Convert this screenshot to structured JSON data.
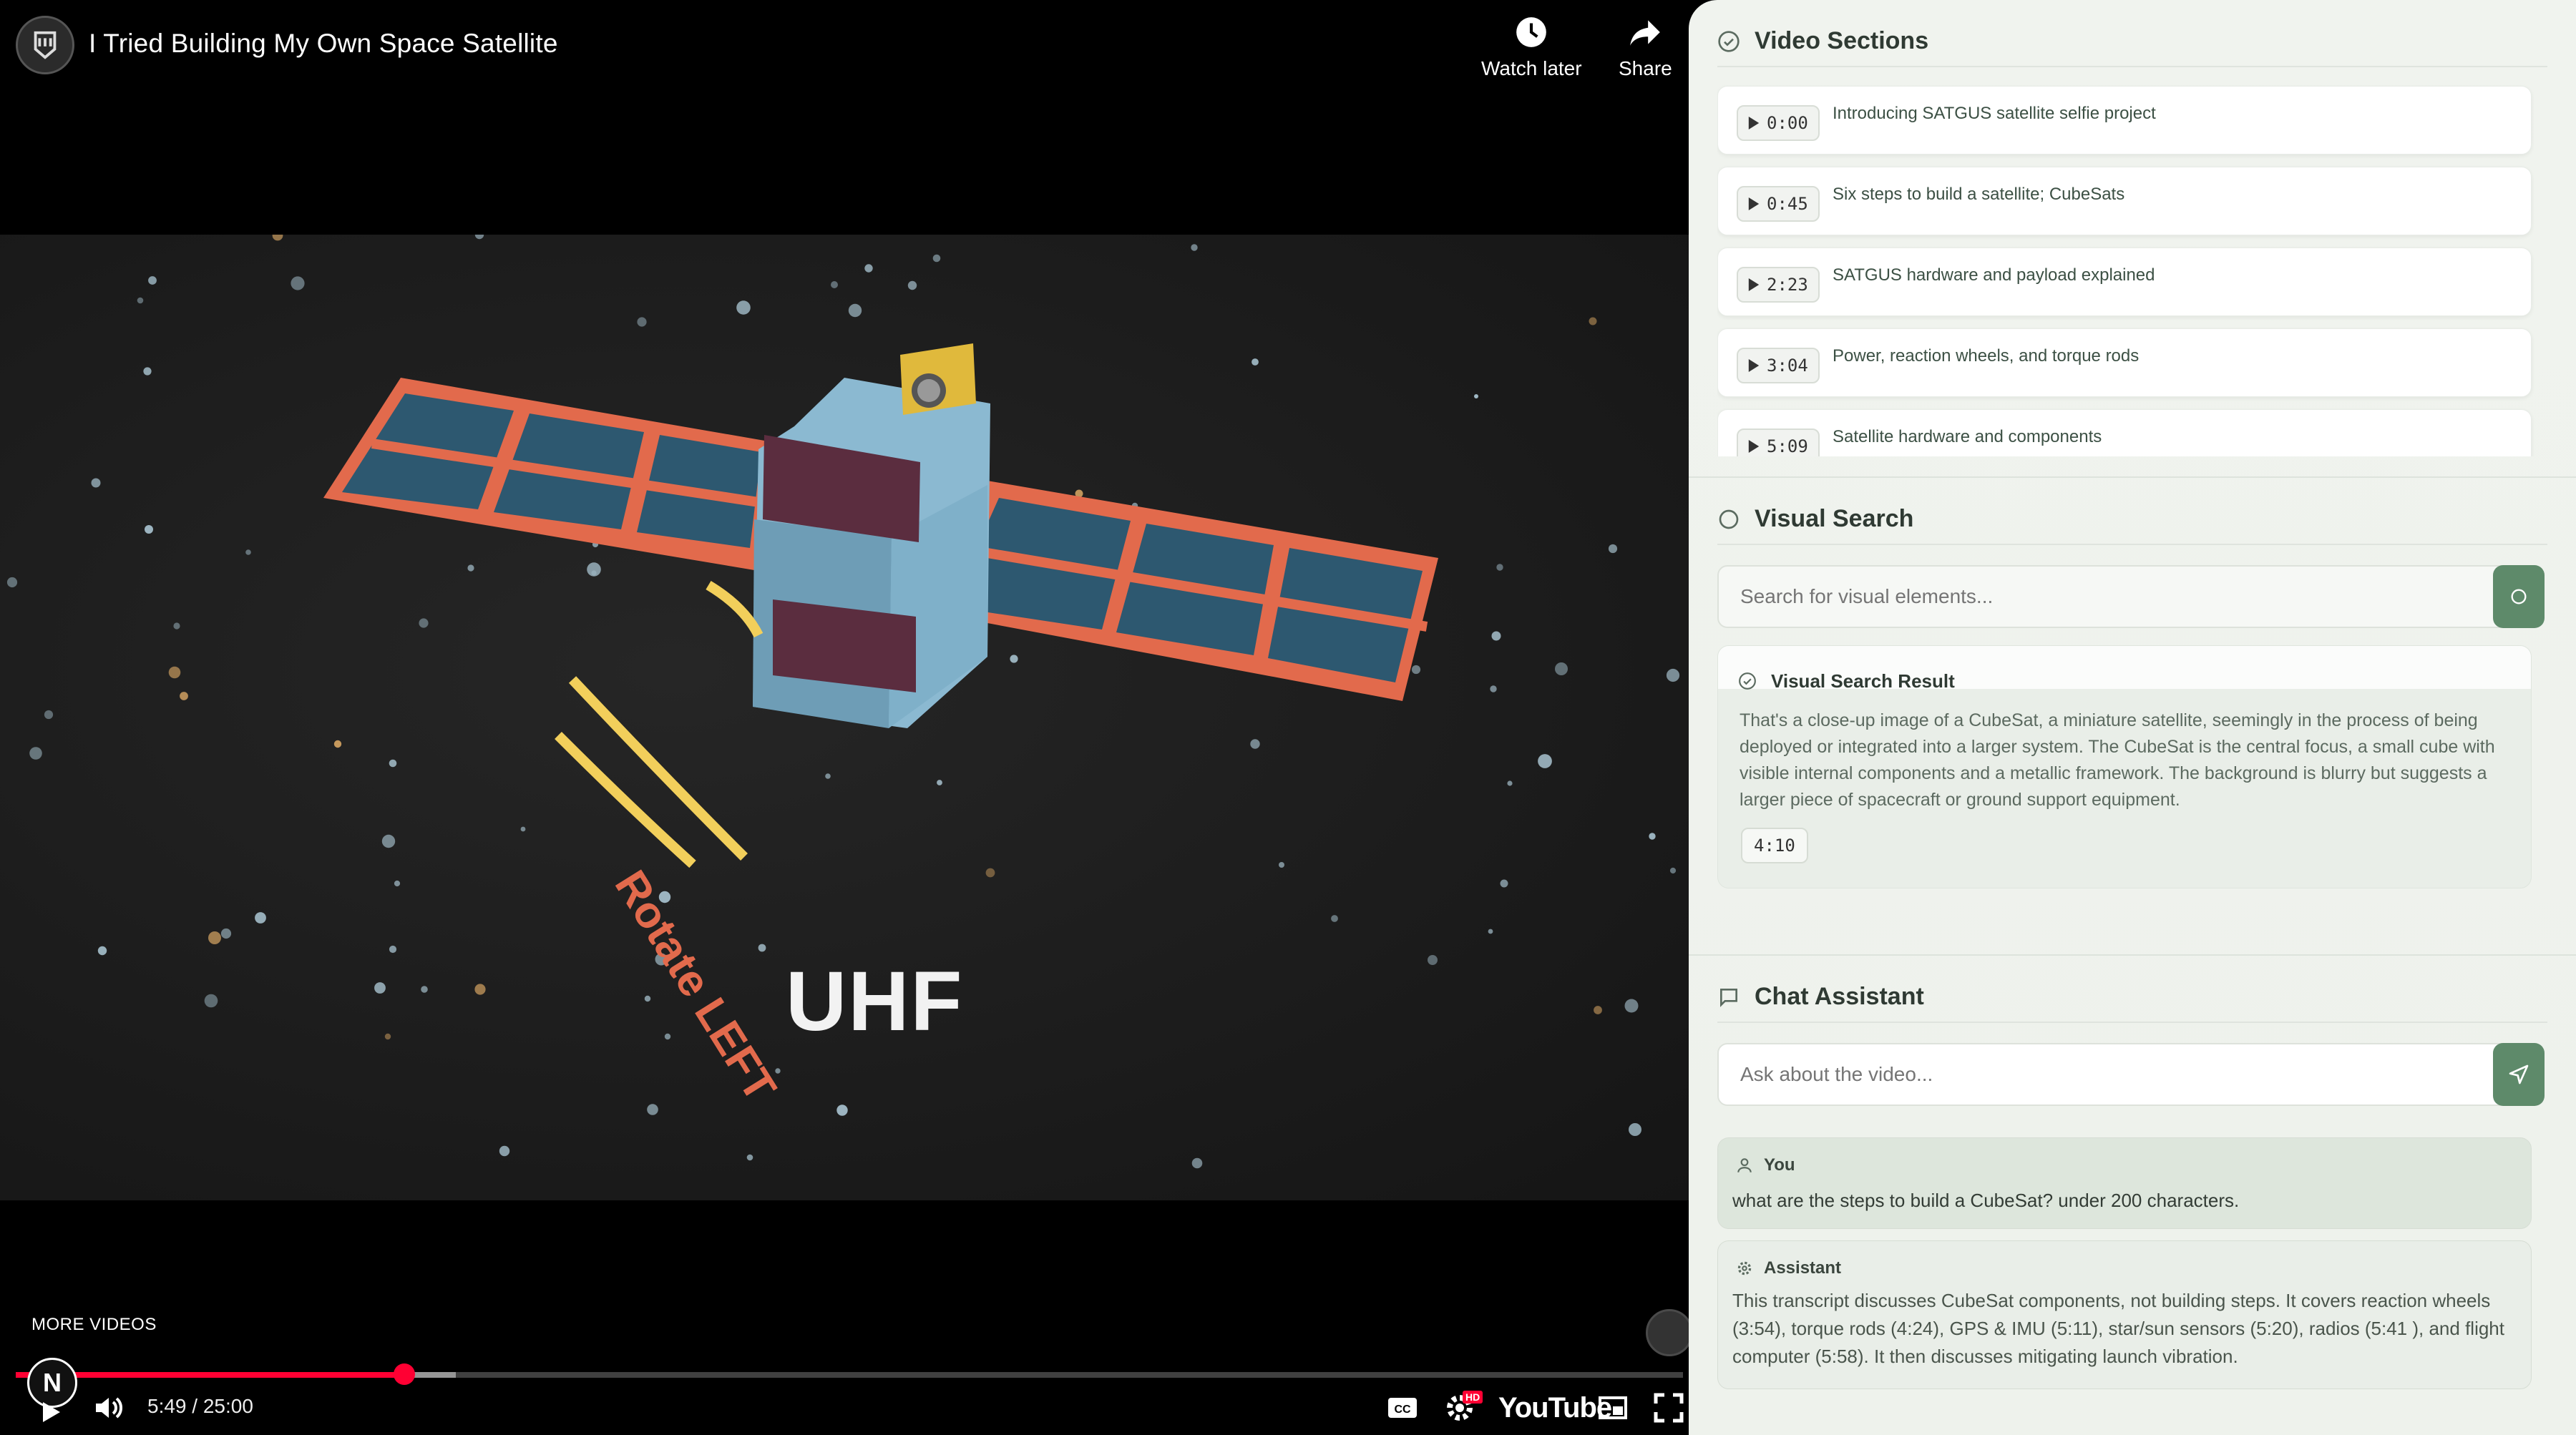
{
  "player": {
    "title": "I Tried Building My Own Space Satellite",
    "watch_later": "Watch later",
    "share": "Share",
    "scene_text": "UHF",
    "rotate_text": "Rotate LEFT",
    "more_videos": "MORE VIDEOS",
    "n_badge": "N",
    "time": "5:49 / 25:00",
    "progress_played_fraction": 0.233,
    "progress_loaded_fraction": 0.264,
    "youtube_label": "YouTube",
    "hd_badge": "HD",
    "icons": [
      "channel-logo-icon",
      "clock-icon",
      "share-arrow-icon",
      "play-icon",
      "volume-icon",
      "captions-icon",
      "settings-gear-icon",
      "miniplayer-icon",
      "fullscreen-icon"
    ],
    "accent_color": "#ff0033"
  },
  "panel": {
    "video_sections": {
      "title": "Video Sections",
      "items": [
        {
          "time": "0:00",
          "label": "Introducing SATGUS satellite selfie project"
        },
        {
          "time": "0:45",
          "label": "Six steps to build a satellite; CubeSats"
        },
        {
          "time": "2:23",
          "label": "SATGUS hardware and payload explained"
        },
        {
          "time": "3:04",
          "label": "Power, reaction wheels, and torque rods"
        },
        {
          "time": "5:09",
          "label": "Satellite hardware and components"
        }
      ]
    },
    "visual_search": {
      "title": "Visual Search",
      "placeholder": "Search for visual elements...",
      "result_title": "Visual Search Result",
      "result_text": "That's a close-up image of a CubeSat, a miniature satellite, seemingly in the process of being deployed or integrated into a larger system. The CubeSat is the central focus, a small cube with visible internal components and a metallic framework. The background is blurry but suggests a larger piece of spacecraft or ground support equipment.",
      "result_time": "4:10"
    },
    "chat": {
      "title": "Chat Assistant",
      "placeholder": "Ask about the video...",
      "messages": [
        {
          "role": "You",
          "text": "what are the steps to build a CubeSat? under 200 characters."
        },
        {
          "role": "Assistant",
          "text": "This transcript discusses CubeSat components, not building steps. It covers reaction wheels (3:54), torque rods (4:24), GPS & IMU (5:11), star/sun sensors (5:20), radios (5:41 ), and flight computer (5:58). It then discusses mitigating launch vibration."
        }
      ]
    },
    "accent_color": "#5e8a6a"
  }
}
